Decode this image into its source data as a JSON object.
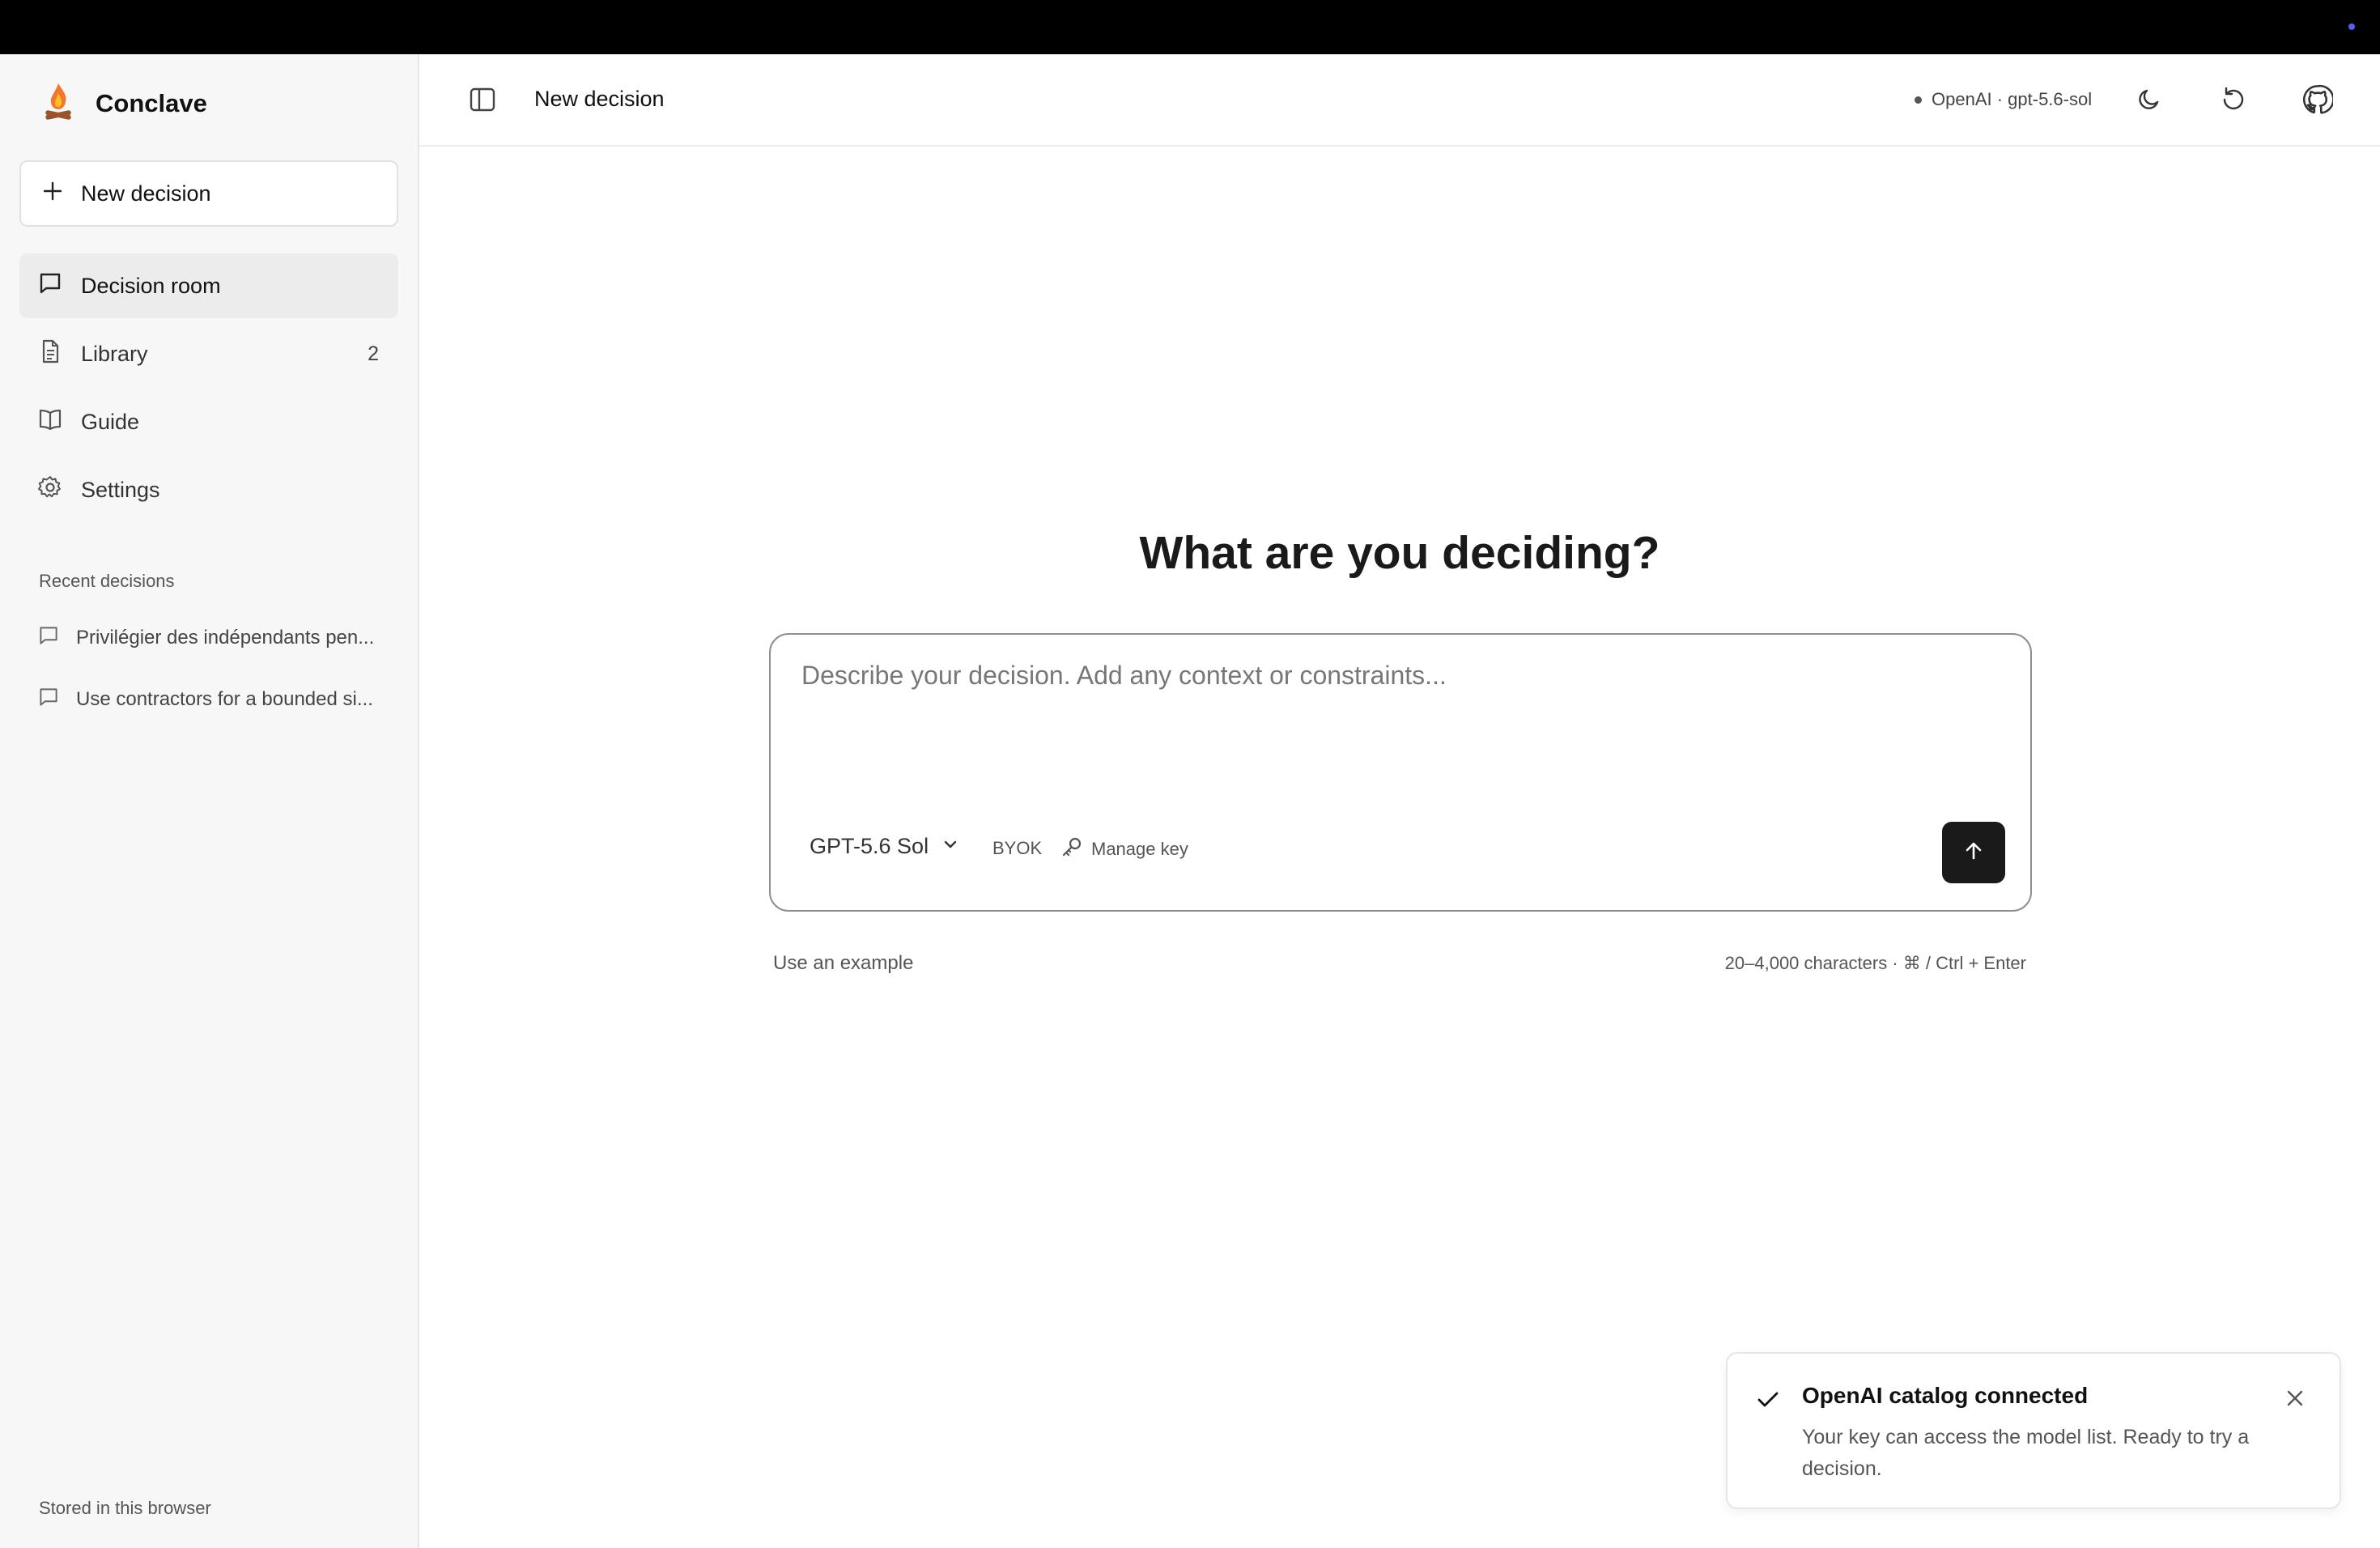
{
  "app": {
    "name": "Conclave",
    "logo_icon": "campfire-icon"
  },
  "sidebar": {
    "new_button_label": "New decision",
    "items": [
      {
        "label": "Decision room",
        "icon": "chat-bubble-icon",
        "active": true
      },
      {
        "label": "Library",
        "icon": "document-icon",
        "count": "2"
      },
      {
        "label": "Guide",
        "icon": "book-icon"
      },
      {
        "label": "Settings",
        "icon": "gear-icon"
      }
    ],
    "recent_label": "Recent decisions",
    "recent": [
      {
        "label": "Privilégier des indépendants pen..."
      },
      {
        "label": "Use contractors for a bounded si..."
      }
    ],
    "footer": "Stored in this browser"
  },
  "header": {
    "title": "New decision",
    "model_status": "OpenAI · gpt-5.6-sol"
  },
  "main": {
    "headline": "What are you deciding?",
    "input_placeholder": "Describe your decision. Add any context or constraints...",
    "input_value": "",
    "model_select": "GPT-5.6 Sol",
    "byok_label": "BYOK",
    "manage_key_label": "Manage key",
    "use_example": "Use an example",
    "char_hint": "20–4,000 characters · ⌘ / Ctrl + Enter"
  },
  "toast": {
    "title": "OpenAI catalog connected",
    "body": "Your key can access the model list. Ready to try a decision."
  },
  "colors": {
    "accent_dark": "#1a1a1a",
    "sidebar_bg": "#f7f7f7",
    "status_dot": "#5b5bf5"
  }
}
